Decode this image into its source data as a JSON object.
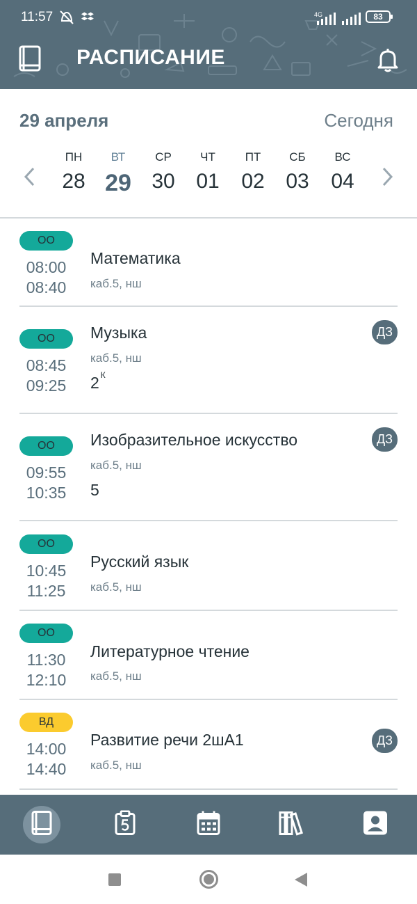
{
  "status_bar": {
    "time": "11:57",
    "network": "4G",
    "battery": "83"
  },
  "app_bar": {
    "title": "РАСПИСАНИЕ",
    "left_icon": "book-icon",
    "right_icon": "bell-icon"
  },
  "date_header": {
    "date_label": "29 апреля",
    "today_button": "Сегодня",
    "prev_arrow": "‹",
    "next_arrow": "›",
    "days": [
      {
        "weekday": "ПН",
        "date": "28",
        "active": false
      },
      {
        "weekday": "ВТ",
        "date": "29",
        "active": true
      },
      {
        "weekday": "СР",
        "date": "30",
        "active": false
      },
      {
        "weekday": "ЧТ",
        "date": "01",
        "active": false
      },
      {
        "weekday": "ПТ",
        "date": "02",
        "active": false
      },
      {
        "weekday": "СБ",
        "date": "03",
        "active": false
      },
      {
        "weekday": "ВС",
        "date": "04",
        "active": false
      }
    ]
  },
  "lessons": [
    {
      "badge": "ОО",
      "badge_type": "oo",
      "start": "08:00",
      "end": "08:40",
      "subject": "Математика",
      "room": "каб.5, нш",
      "grade": "",
      "grade_sup": "",
      "homework": ""
    },
    {
      "badge": "ОО",
      "badge_type": "oo",
      "start": "08:45",
      "end": "09:25",
      "subject": "Музыка",
      "room": "каб.5, нш",
      "grade": "2",
      "grade_sup": "К",
      "homework": "ДЗ"
    },
    {
      "badge": "ОО",
      "badge_type": "oo",
      "start": "09:55",
      "end": "10:35",
      "subject": "Изобразительное искусство",
      "room": "каб.5, нш",
      "grade": "5",
      "grade_sup": "",
      "homework": "ДЗ"
    },
    {
      "badge": "ОО",
      "badge_type": "oo",
      "start": "10:45",
      "end": "11:25",
      "subject": "Русский язык",
      "room": "каб.5, нш",
      "grade": "",
      "grade_sup": "",
      "homework": ""
    },
    {
      "badge": "ОО",
      "badge_type": "oo",
      "start": "11:30",
      "end": "12:10",
      "subject": "Литературное чтение",
      "room": "каб.5, нш",
      "grade": "",
      "grade_sup": "",
      "homework": ""
    },
    {
      "badge": "ВД",
      "badge_type": "vd",
      "start": "14:00",
      "end": "14:40",
      "subject": "Развитие речи 2шА1",
      "room": "каб.5, нш",
      "grade": "",
      "grade_sup": "",
      "homework": "ДЗ"
    }
  ],
  "bottom_nav": [
    {
      "icon": "schedule-book-icon",
      "active": true
    },
    {
      "icon": "grades-clipboard-icon",
      "active": false
    },
    {
      "icon": "calendar-icon",
      "active": false
    },
    {
      "icon": "library-icon",
      "active": false
    },
    {
      "icon": "profile-icon",
      "active": false
    }
  ],
  "colors": {
    "header": "#566d7a",
    "badge_oo": "#14a99a",
    "badge_vd": "#fbcb2e",
    "accent_text": "#5a6f7c",
    "divider": "#d4d9dc"
  }
}
